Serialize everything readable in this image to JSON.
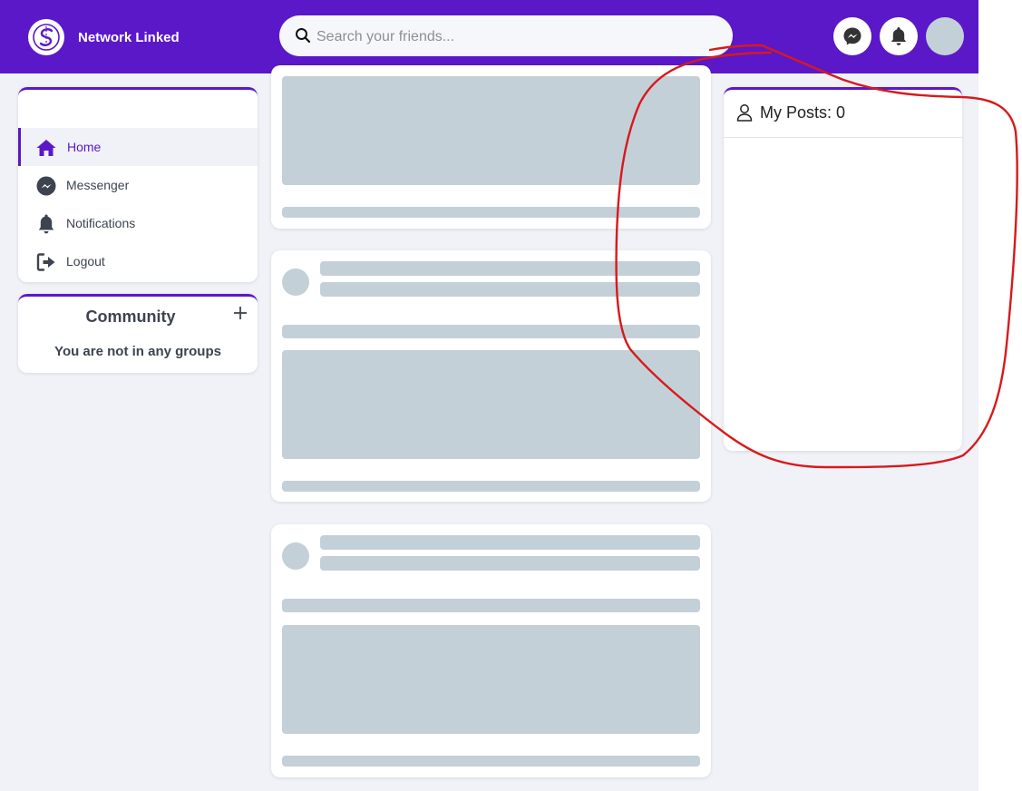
{
  "header": {
    "brand": "Network Linked",
    "search": {
      "placeholder": "Search your friends...",
      "value": ""
    },
    "icons": [
      "logo-icon",
      "search-icon",
      "messenger-icon",
      "bell-icon",
      "avatar"
    ]
  },
  "sidebar": {
    "items": [
      {
        "label": "Home",
        "icon": "home-icon",
        "active": true
      },
      {
        "label": "Messenger",
        "icon": "messenger-icon",
        "active": false
      },
      {
        "label": "Notifications",
        "icon": "bell-icon",
        "active": false
      },
      {
        "label": "Logout",
        "icon": "logout-icon",
        "active": false
      }
    ],
    "community": {
      "title": "Community",
      "add_icon": "plus-icon",
      "empty_text": "You are not in any groups"
    }
  },
  "feed": {
    "state": "loading",
    "skeleton_posts": 3
  },
  "right_panel": {
    "my_posts_label": "My Posts: 0",
    "icon": "user-icon"
  },
  "colors": {
    "primary": "#5b18c9",
    "background": "#f0f2f7",
    "skeleton": "#c4d0d8",
    "annotation": "#d8191c"
  }
}
